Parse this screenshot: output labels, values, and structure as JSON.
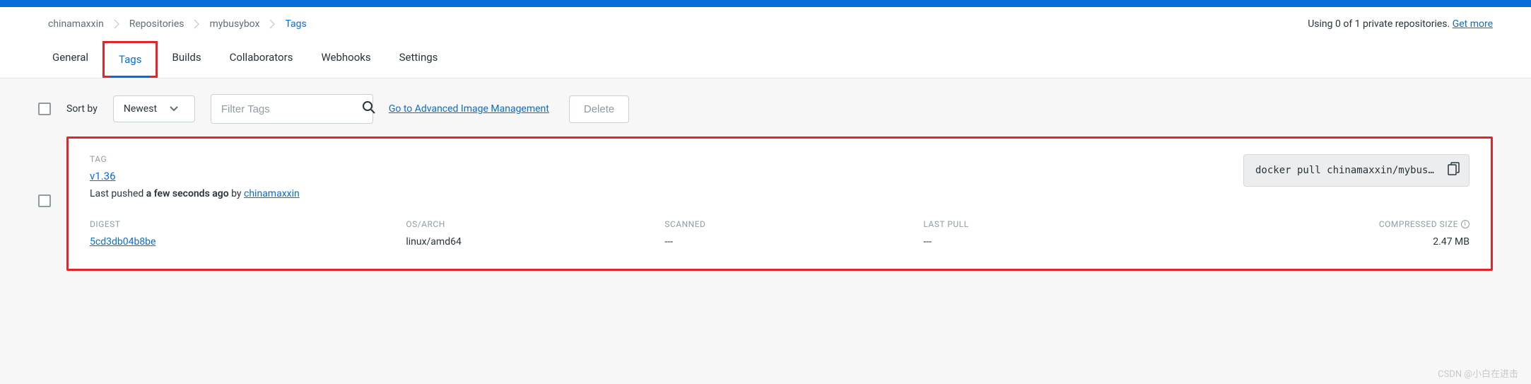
{
  "breadcrumb": [
    "chinamaxxin",
    "Repositories",
    "mybusybox",
    "Tags"
  ],
  "repo_usage": {
    "prefix": "Using 0 of 1 private repositories. ",
    "link": "Get more"
  },
  "tabs": [
    "General",
    "Tags",
    "Builds",
    "Collaborators",
    "Webhooks",
    "Settings"
  ],
  "active_tab_index": 1,
  "toolbar": {
    "sortby_label": "Sort by",
    "sort_value": "Newest",
    "filter_placeholder": "Filter Tags",
    "advanced_link": "Go to Advanced Image Management",
    "delete_label": "Delete"
  },
  "tag": {
    "section_label": "TAG",
    "name": "v1.36",
    "pushed_prefix": "Last pushed ",
    "pushed_time": "a few seconds ago",
    "pushed_mid": " by ",
    "pushed_by": "chinamaxxin",
    "pull_cmd": "docker pull chinamaxxin/mybusybo…",
    "columns": {
      "digest": "DIGEST",
      "osarch": "OS/ARCH",
      "scanned": "SCANNED",
      "lastpull": "LAST PULL",
      "size": "COMPRESSED SIZE"
    },
    "row": {
      "digest": "5cd3db04b8be",
      "osarch": "linux/amd64",
      "scanned": "---",
      "lastpull": "---",
      "size": "2.47 MB"
    }
  },
  "watermark": "CSDN @小白在进击"
}
